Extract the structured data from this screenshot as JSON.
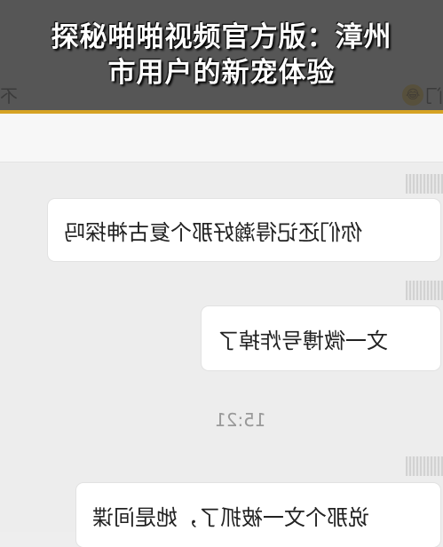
{
  "banner": {
    "line1": "探秘啪啪视频官方版：漳州",
    "line2": "市用户的新宠体验"
  },
  "background": {
    "left_fragment": "不",
    "right_fragment": "门",
    "emoji": "😂"
  },
  "messages": [
    {
      "text": "你们还记得瀚好那个复古神探吗"
    },
    {
      "text": "文一微博号炸掉了"
    },
    {
      "text": "说那个文一被抓了，她是间谍"
    }
  ],
  "timestamp": "15:21",
  "colors": {
    "banner_bg": "#3c3c3c",
    "banner_border": "#d6a324",
    "chat_bg": "#ededed",
    "bubble_bg": "#ffffff"
  }
}
